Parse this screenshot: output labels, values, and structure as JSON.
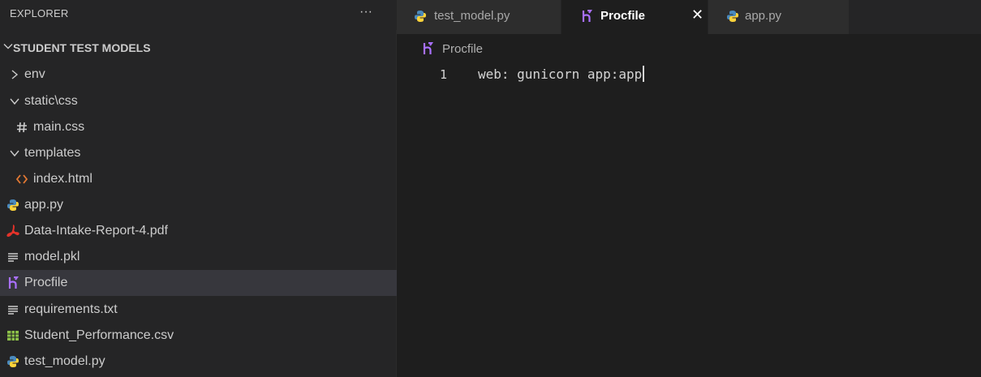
{
  "explorer": {
    "title": "EXPLORER",
    "more": "···",
    "folder": "STUDENT TEST MODELS"
  },
  "tree": [
    {
      "label": "env",
      "icon": "chevron-right-icon"
    },
    {
      "label": "static\\css",
      "icon": "chevron-down-icon"
    },
    {
      "label": "main.css",
      "icon": "css-hash-icon"
    },
    {
      "label": "templates",
      "icon": "chevron-down-icon"
    },
    {
      "label": "index.html",
      "icon": "html-brackets-icon"
    },
    {
      "label": "app.py",
      "icon": "python-icon"
    },
    {
      "label": "Data-Intake-Report-4.pdf",
      "icon": "pdf-icon"
    },
    {
      "label": "model.pkl",
      "icon": "text-lines-icon"
    },
    {
      "label": "Procfile",
      "icon": "heroku-icon",
      "selected": true
    },
    {
      "label": "requirements.txt",
      "icon": "text-lines-icon"
    },
    {
      "label": "Student_Performance.csv",
      "icon": "csv-table-icon"
    },
    {
      "label": "test_model.py",
      "icon": "python-icon"
    }
  ],
  "tabs": [
    {
      "label": "test_model.py",
      "icon": "python-icon"
    },
    {
      "label": "Procfile",
      "icon": "heroku-icon",
      "active": true,
      "close": "✕"
    },
    {
      "label": "app.py",
      "icon": "python-icon"
    }
  ],
  "editor": {
    "breadcrumb": "Procfile",
    "line_number": "1",
    "code": "web: gunicorn app:app"
  },
  "colors": {
    "heroku": "#a970ff",
    "python_blue": "#4b8bbe",
    "python_yellow": "#ffd43b",
    "pdf": "#e5332a",
    "html": "#e37933",
    "css": "#cccccc",
    "csv": "#8dc149",
    "selection": "#37373d"
  }
}
